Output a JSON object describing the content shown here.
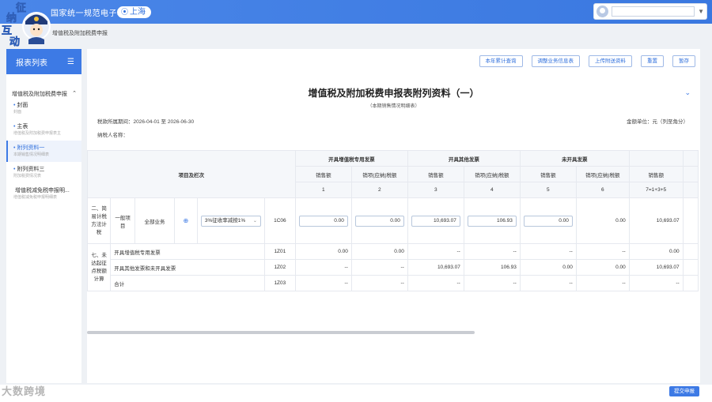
{
  "header": {
    "title": "国家统一规范电子税务局",
    "region": "上海"
  },
  "mascot": {
    "chars": [
      "征",
      "纳",
      "互",
      "动"
    ]
  },
  "breadcrumb": "增值税及附加税费申报",
  "sidebar": {
    "title": "报表列表",
    "group": "增值税及附加税费申报",
    "items": [
      {
        "label": "封面",
        "sub": "封面"
      },
      {
        "label": "主表",
        "sub": "增值税及附加税费申报表主"
      },
      {
        "label": "附列资料一",
        "sub": "本期销售情况明细表"
      },
      {
        "label": "附列资料三",
        "sub": "附加税费情况表"
      },
      {
        "label": "增值税减免税申报明...",
        "sub": "增值税减免税申报明细表"
      }
    ]
  },
  "toolbar": {
    "buttons": [
      "本年累计查询",
      "调整业务信息表",
      "上传附送资料",
      "重置",
      "暂存"
    ]
  },
  "form": {
    "title": "增值税及附加税费申报表附列资料（一）",
    "subtitle": "（本期销售情况明细表）",
    "period": "税款所属期间：2026-04-01 至 2026-06-30",
    "unit": "金额单位：元（列至角分）",
    "payer": "纳税人名称："
  },
  "table": {
    "header_items": "项目及栏次",
    "groups": [
      "开具增值税专用发票",
      "开具其他发票",
      "未开具发票"
    ],
    "sub_headers": [
      "销售额",
      "销项(应纳)税额",
      "销售额",
      "销项(应纳)税额",
      "销售额",
      "销项(应纳)税额",
      "销售额"
    ],
    "col_nums": [
      "1",
      "2",
      "3",
      "4",
      "5",
      "6",
      "7=1+3+5"
    ],
    "section2": "二、简易计税方法计税",
    "general_item": "一般项目",
    "all_business": "全部业务",
    "select_value": "3%征收率减按1%",
    "row1": {
      "code": "1C06",
      "values": [
        "0.00",
        "0.00",
        "10,693.07",
        "106.93",
        "0.00",
        "0.00",
        "10,693.07"
      ]
    },
    "section7": "七、未达起征点税额计算",
    "row2": {
      "label": "开具增值税专用发票",
      "code": "1Z01",
      "values": [
        "0.00",
        "0.00",
        "--",
        "--",
        "--",
        "--",
        "0.00"
      ]
    },
    "row3": {
      "label": "开具其他发票和未开具发票",
      "code": "1Z02",
      "values": [
        "--",
        "--",
        "10,693.07",
        "106.93",
        "0.00",
        "0.00",
        "10,693.07"
      ]
    },
    "row4": {
      "label": "合计",
      "code": "1Z03",
      "values": [
        "--",
        "--",
        "--",
        "--",
        "--",
        "--",
        "--"
      ]
    }
  },
  "footer": {
    "submit": "提交申报",
    "watermark": "大数跨境"
  }
}
